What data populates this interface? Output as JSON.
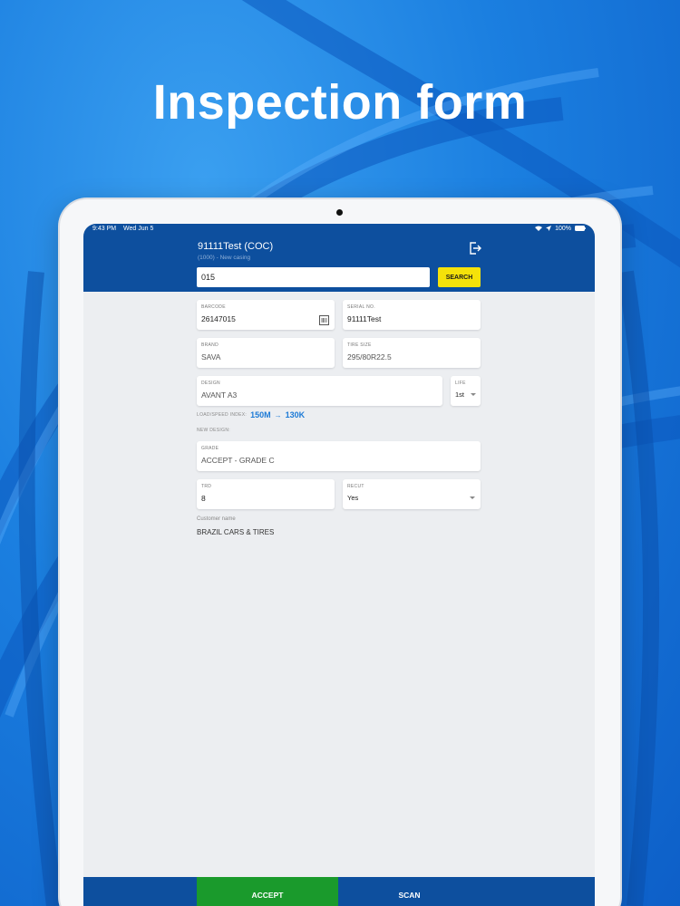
{
  "hero": {
    "title": "Inspection form"
  },
  "status_bar": {
    "time": "9:43 PM",
    "date": "Wed Jun 5",
    "battery": "100%"
  },
  "header": {
    "title": "91111Test (COC)",
    "subtitle": "(1000) - New casing",
    "search_value": "015",
    "search_button": "SEARCH"
  },
  "form": {
    "barcode": {
      "label": "BARCODE",
      "value": "26147015"
    },
    "serial_no": {
      "label": "SERIAL NO.",
      "value": "91111Test"
    },
    "brand": {
      "label": "BRAND",
      "value": "SAVA"
    },
    "tire_size": {
      "label": "TIRE SIZE",
      "value": "295/80R22.5"
    },
    "design": {
      "label": "DESIGN",
      "value": "AVANT A3"
    },
    "life": {
      "label": "LIFE",
      "value": "1st"
    },
    "load_speed": {
      "label": "LOAD/SPEED INDEX:",
      "from": "150M",
      "arrow": "→",
      "to": "130K"
    },
    "new_design_label": "NEW DESIGN:",
    "grade": {
      "label": "GRADE",
      "value": "ACCEPT - GRADE C"
    },
    "trd": {
      "label": "TRD",
      "value": "8"
    },
    "recut": {
      "label": "RECUT",
      "value": "Yes"
    },
    "customer": {
      "label": "Customer name",
      "value": "BRAZIL CARS & TIRES"
    }
  },
  "bottom_bar": {
    "accept": "ACCEPT",
    "scan": "SCAN"
  },
  "colors": {
    "header": "#0d4f9e",
    "accept": "#1a9a2c",
    "search": "#f5e20a",
    "link": "#1c7ad6"
  }
}
